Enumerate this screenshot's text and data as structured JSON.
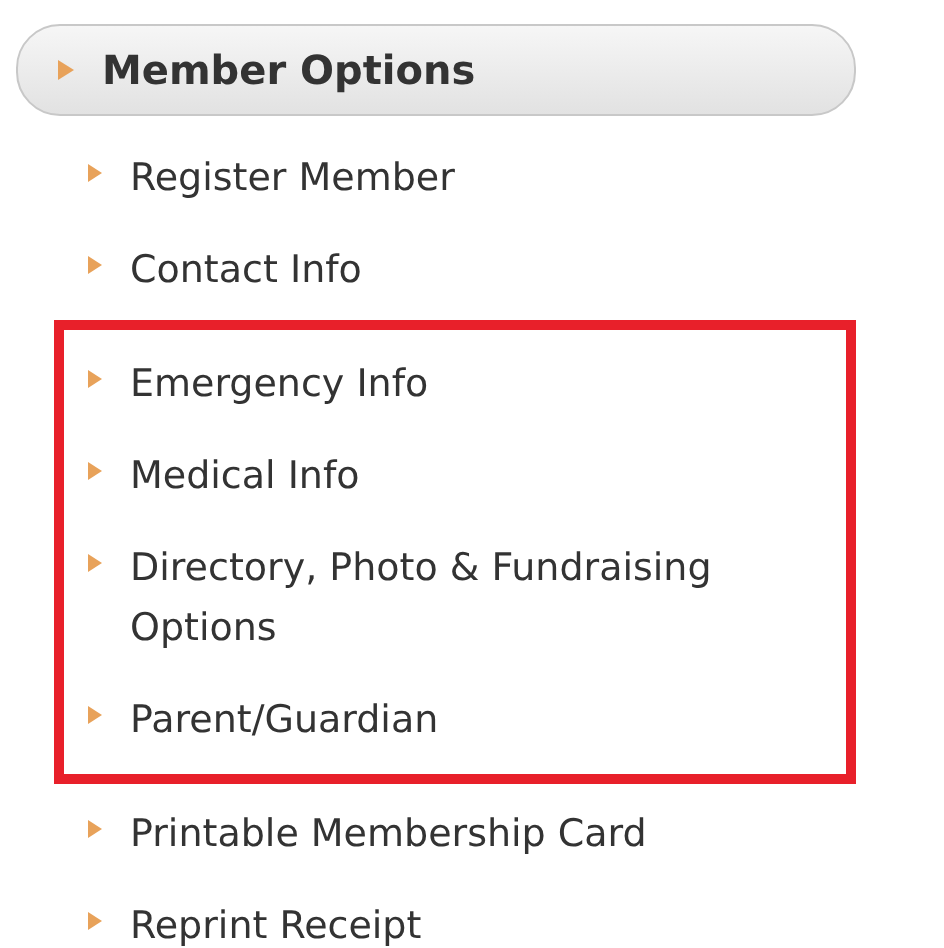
{
  "menu": {
    "title": "Member Options",
    "items": [
      {
        "label": "Register Member",
        "highlighted": false
      },
      {
        "label": "Contact Info",
        "highlighted": false
      },
      {
        "label": "Emergency Info",
        "highlighted": true
      },
      {
        "label": "Medical Info",
        "highlighted": true
      },
      {
        "label": "Directory, Photo & Fundraising Options",
        "highlighted": true
      },
      {
        "label": "Parent/Guardian",
        "highlighted": true
      },
      {
        "label": "Printable Membership Card",
        "highlighted": false
      },
      {
        "label": "Reprint Receipt",
        "highlighted": false
      }
    ]
  }
}
